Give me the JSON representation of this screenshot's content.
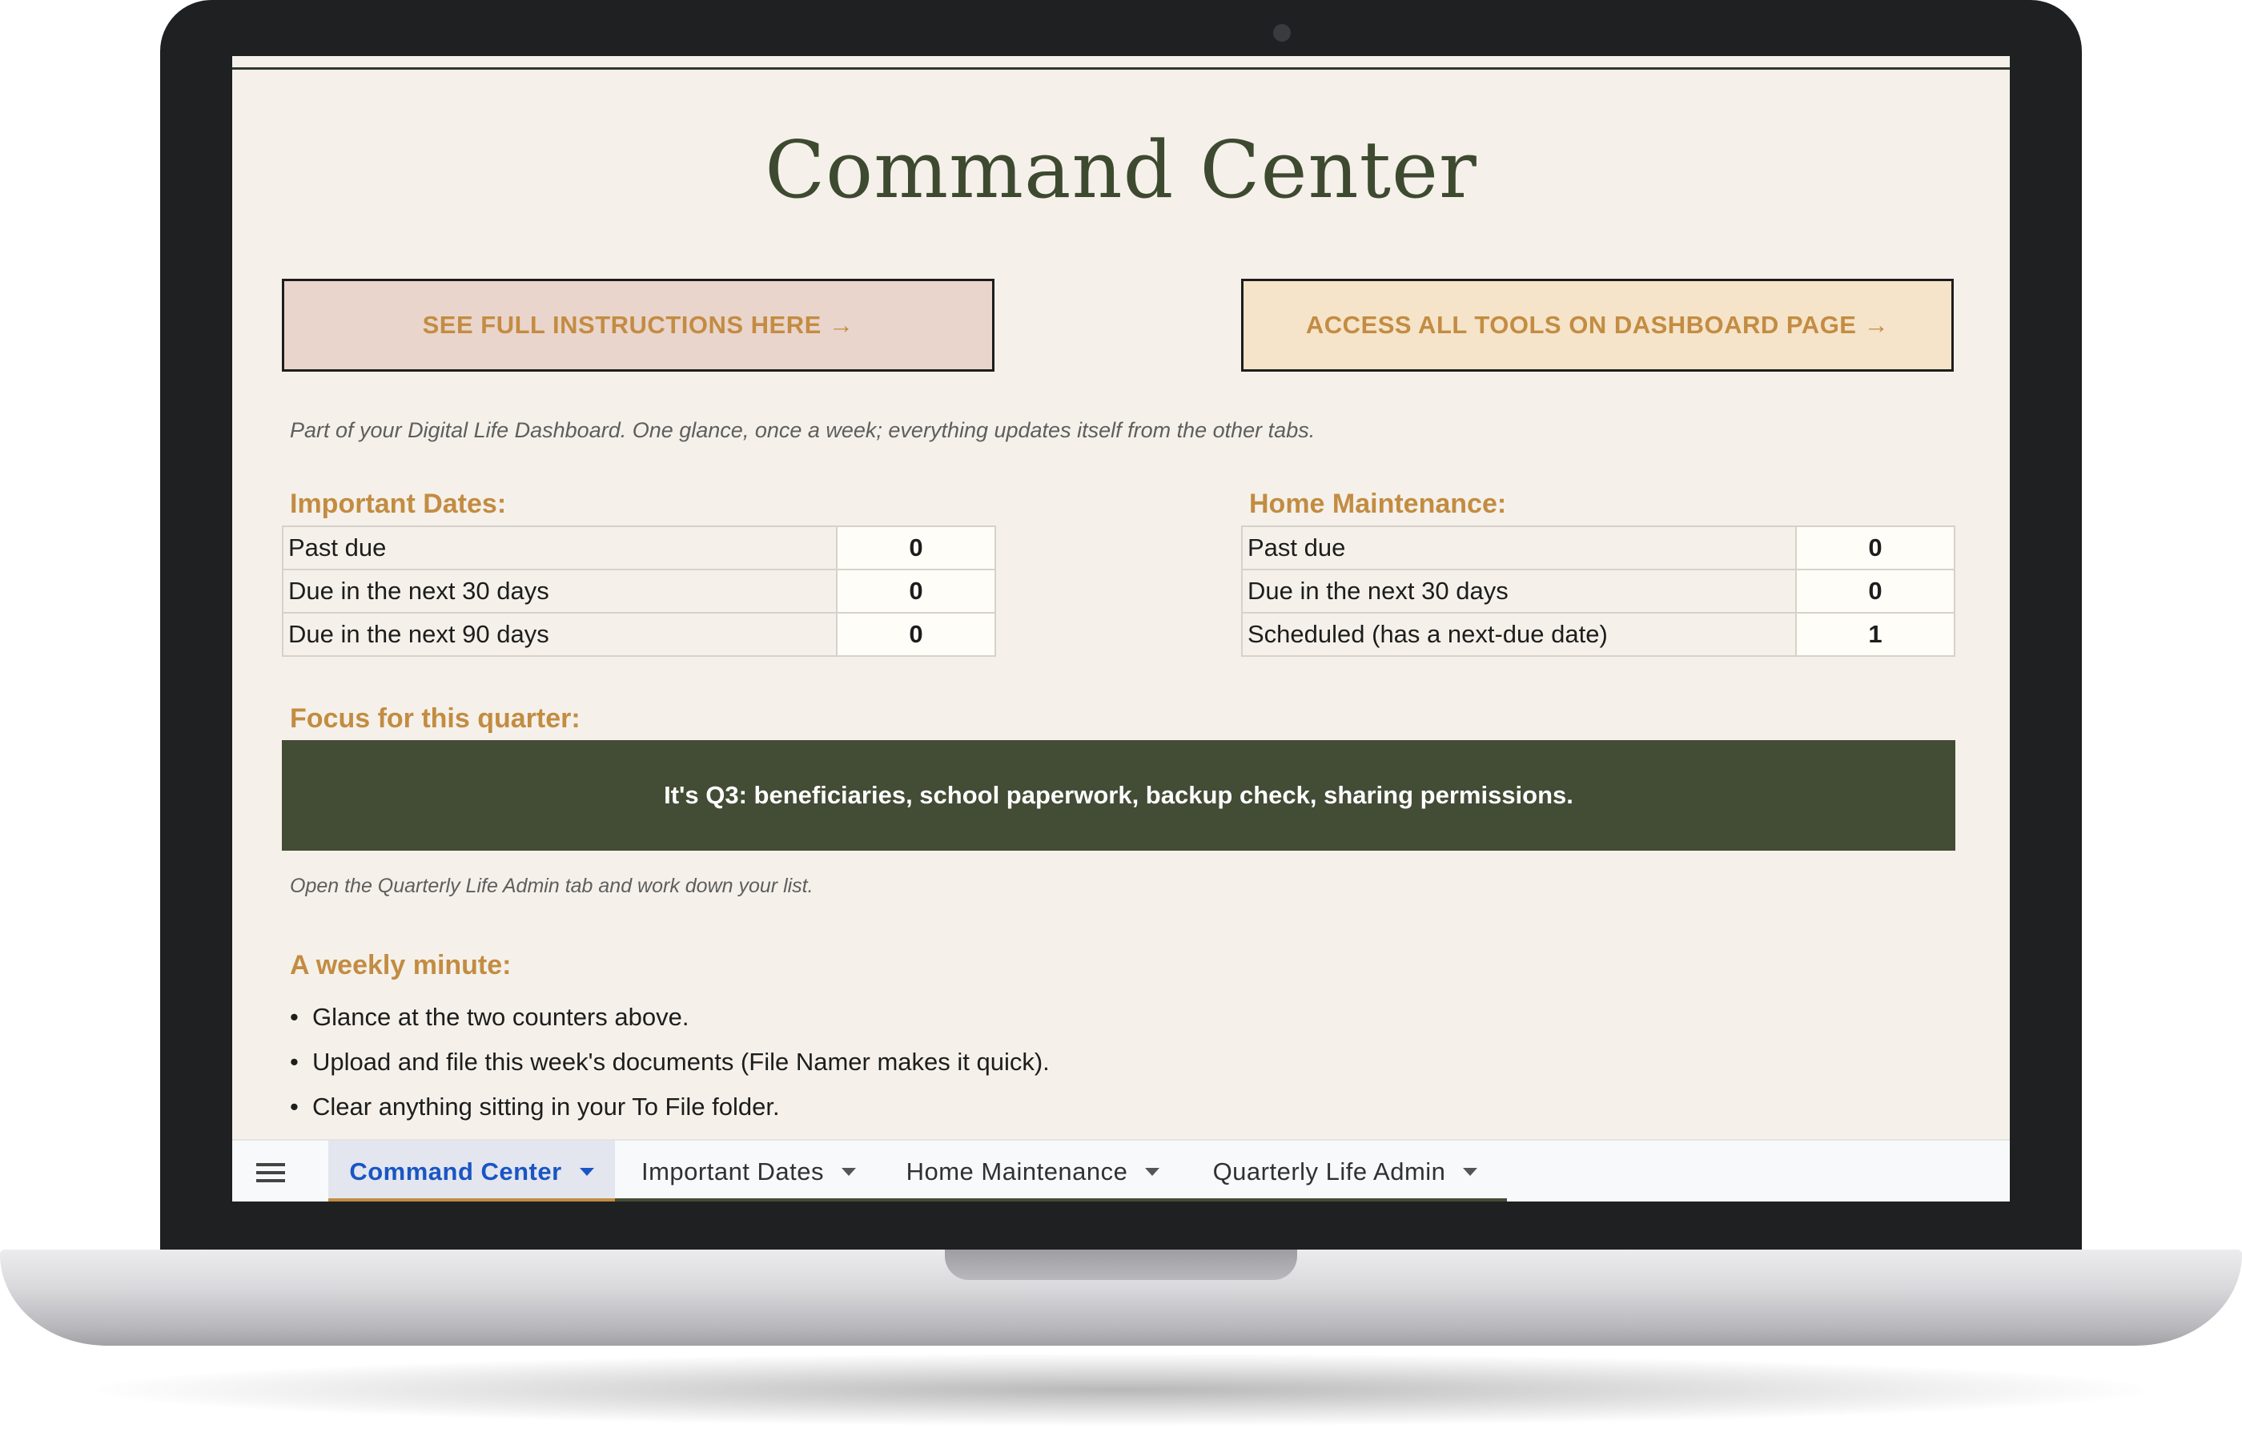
{
  "page": {
    "title": "Command Center",
    "cta_left": "SEE FULL INSTRUCTIONS HERE →",
    "cta_right": "ACCESS ALL TOOLS ON DASHBOARD PAGE →",
    "subtitle": "Part of your Digital Life Dashboard. One glance, once a week; everything updates itself from the other tabs."
  },
  "important_dates": {
    "heading": "Important Dates:",
    "rows": [
      {
        "label": "Past due",
        "value": "0"
      },
      {
        "label": "Due in the next 30 days",
        "value": "0"
      },
      {
        "label": "Due in the next 90 days",
        "value": "0"
      }
    ]
  },
  "home_maintenance": {
    "heading": "Home Maintenance:",
    "rows": [
      {
        "label": "Past due",
        "value": "0"
      },
      {
        "label": "Due in the next 30 days",
        "value": "0"
      },
      {
        "label": "Scheduled (has a next-due date)",
        "value": "1"
      }
    ]
  },
  "focus": {
    "heading": "Focus for this quarter:",
    "banner": "It's Q3: beneficiaries, school paperwork, backup check, sharing permissions.",
    "note": "Open the Quarterly Life Admin tab and work down your list."
  },
  "weekly": {
    "heading": "A weekly minute:",
    "items": [
      "Glance at the two counters above.",
      "Upload and file this week's documents (File Namer makes it quick).",
      "Clear anything sitting in your To File folder."
    ]
  },
  "sheet_tabs": [
    {
      "label": "Command Center",
      "active": true,
      "color": "#c38c42"
    },
    {
      "label": "Important Dates",
      "active": false,
      "color": "#434c35"
    },
    {
      "label": "Home Maintenance",
      "active": false,
      "color": "#434c35"
    },
    {
      "label": "Quarterly Life Admin",
      "active": false,
      "color": "#434c35"
    }
  ],
  "icons": {
    "menu": "hamburger-menu-icon",
    "caret": "chevron-down-icon"
  },
  "colors": {
    "accent": "#c38c42",
    "dark_green": "#434c35",
    "background": "#f5f1ea"
  }
}
